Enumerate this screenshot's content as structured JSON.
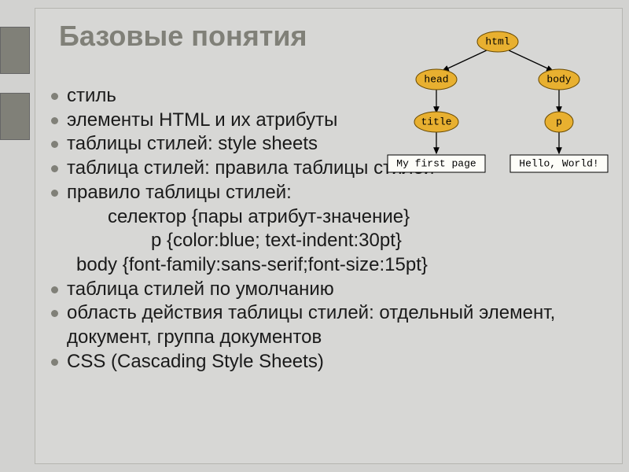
{
  "title": "Базовые понятия",
  "bullets": {
    "b1": "стиль",
    "b2": "элементы HTML и их атрибуты",
    "b3": "таблицы стилей: style sheets",
    "b4": "таблица стилей: правила таблицы стилей",
    "b5": "правило таблицы стилей:",
    "b5s1": "селектор {пары атрибут-значение}",
    "b5s2": "p {color:blue; text-indent:30pt}",
    "b5s3": "body {font-family:sans-serif;font-size:15pt}",
    "b6": "таблица стилей по умолчанию",
    "b7": "область действия таблицы стилей: отдельный элемент, документ, группа документов",
    "b8": "CSS (Cascading Style Sheets)"
  },
  "tree": {
    "html": "html",
    "head": "head",
    "body": "body",
    "title": "title",
    "p": "p",
    "leaf1": "My first page",
    "leaf2": "Hello, World!"
  }
}
